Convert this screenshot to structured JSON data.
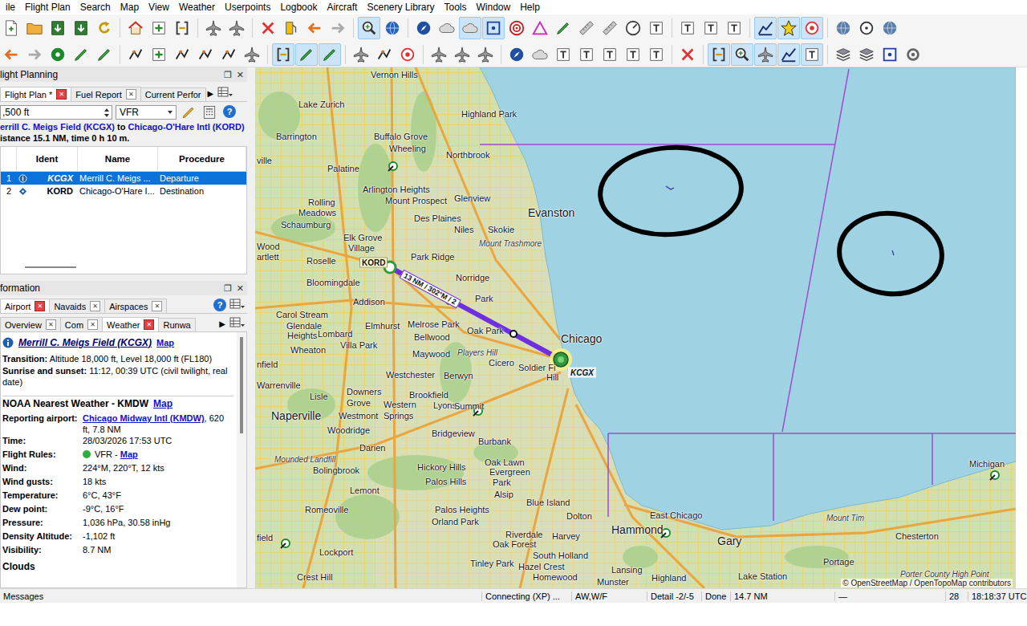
{
  "menu": [
    "ile",
    "Flight Plan",
    "Search",
    "Map",
    "View",
    "Weather",
    "Userpoints",
    "Logbook",
    "Aircraft",
    "Scenery Library",
    "Tools",
    "Window",
    "Help"
  ],
  "toolbar": [
    [
      {
        "kind": "new",
        "selected": false
      },
      {
        "kind": "open",
        "selected": false
      },
      {
        "kind": "save",
        "selected": false
      },
      {
        "kind": "save",
        "selected": false
      },
      {
        "kind": "refresh",
        "selected": false
      },
      {
        "kind": "sep",
        "selected": false
      },
      {
        "kind": "home",
        "selected": false
      },
      {
        "kind": "plus",
        "selected": false
      },
      {
        "kind": "bracket",
        "selected": false
      },
      {
        "kind": "sep",
        "selected": false
      },
      {
        "kind": "plane",
        "selected": false
      },
      {
        "kind": "plane",
        "selected": false
      },
      {
        "kind": "sep",
        "selected": false
      },
      {
        "kind": "cross",
        "selected": false
      },
      {
        "kind": "fuel",
        "selected": false
      },
      {
        "kind": "back",
        "selected": false
      },
      {
        "kind": "forward",
        "selected": false
      },
      {
        "kind": "sep",
        "selected": false
      },
      {
        "kind": "search",
        "selected": true
      },
      {
        "kind": "globe",
        "selected": false
      },
      {
        "kind": "sep",
        "selected": false
      },
      {
        "kind": "compass",
        "selected": false
      },
      {
        "kind": "cloud",
        "selected": false
      },
      {
        "kind": "cloud",
        "selected": true
      },
      {
        "kind": "square",
        "selected": true
      },
      {
        "kind": "radar",
        "selected": false
      },
      {
        "kind": "triangle",
        "selected": false
      },
      {
        "kind": "pen",
        "selected": false
      },
      {
        "kind": "ruler",
        "selected": false
      },
      {
        "kind": "ruler",
        "selected": false
      },
      {
        "kind": "gauge",
        "selected": false
      },
      {
        "kind": "text",
        "selected": false
      },
      {
        "kind": "sep",
        "selected": false
      },
      {
        "kind": "text",
        "selected": false
      },
      {
        "kind": "text",
        "selected": false
      },
      {
        "kind": "text",
        "selected": false
      },
      {
        "kind": "sep",
        "selected": false
      },
      {
        "kind": "chart",
        "selected": true
      },
      {
        "kind": "star",
        "selected": true
      },
      {
        "kind": "target",
        "selected": true
      },
      {
        "kind": "sep",
        "selected": false
      },
      {
        "kind": "sphere",
        "selected": false
      },
      {
        "kind": "circle",
        "selected": false
      },
      {
        "kind": "sphere",
        "selected": false
      }
    ],
    [
      {
        "kind": "back",
        "selected": false
      },
      {
        "kind": "forward",
        "selected": false
      },
      {
        "kind": "circlegreen",
        "selected": false
      },
      {
        "kind": "pen",
        "selected": false
      },
      {
        "kind": "pen",
        "selected": false
      },
      {
        "kind": "sep",
        "selected": false
      },
      {
        "kind": "route",
        "selected": false
      },
      {
        "kind": "plus",
        "selected": false
      },
      {
        "kind": "route",
        "selected": false
      },
      {
        "kind": "route",
        "selected": false
      },
      {
        "kind": "route",
        "selected": false
      },
      {
        "kind": "plane",
        "selected": false
      },
      {
        "kind": "sep",
        "selected": false
      },
      {
        "kind": "bracket",
        "selected": true
      },
      {
        "kind": "pen",
        "selected": true
      },
      {
        "kind": "pen",
        "selected": true
      },
      {
        "kind": "sep",
        "selected": false
      },
      {
        "kind": "plane",
        "selected": false
      },
      {
        "kind": "route",
        "selected": false
      },
      {
        "kind": "target",
        "selected": false
      },
      {
        "kind": "sep",
        "selected": false
      },
      {
        "kind": "plane",
        "selected": false
      },
      {
        "kind": "plane",
        "selected": false
      },
      {
        "kind": "plane",
        "selected": false
      },
      {
        "kind": "sep",
        "selected": false
      },
      {
        "kind": "compass",
        "selected": false
      },
      {
        "kind": "cloud",
        "selected": false
      },
      {
        "kind": "text",
        "selected": false
      },
      {
        "kind": "text",
        "selected": false
      },
      {
        "kind": "text",
        "selected": false
      },
      {
        "kind": "text",
        "selected": false
      },
      {
        "kind": "text",
        "selected": false
      },
      {
        "kind": "sep",
        "selected": false
      },
      {
        "kind": "cross",
        "selected": false
      },
      {
        "kind": "sep",
        "selected": false
      },
      {
        "kind": "bracket",
        "selected": true
      },
      {
        "kind": "search",
        "selected": true
      },
      {
        "kind": "plane",
        "selected": true
      },
      {
        "kind": "chart",
        "selected": true
      },
      {
        "kind": "text",
        "selected": true
      },
      {
        "kind": "sep",
        "selected": false
      },
      {
        "kind": "layers",
        "selected": false
      },
      {
        "kind": "layers",
        "selected": false
      },
      {
        "kind": "square",
        "selected": false
      },
      {
        "kind": "gear",
        "selected": false
      }
    ]
  ],
  "flight_planning": {
    "title": "light Planning",
    "dock_buttons": [
      "❐",
      "✕"
    ],
    "close_glyph": "✕",
    "tabs": [
      {
        "label": "Flight Plan *",
        "selected": true,
        "closable": true
      },
      {
        "label": "Fuel Report",
        "selected": false,
        "closable": true
      },
      {
        "label": "Current Perfor",
        "selected": false,
        "closable": false
      }
    ],
    "more": "▶",
    "altitude": ",500 ft",
    "flight_rules": "VFR",
    "help": "?",
    "route": {
      "from": "errill C. Meigs Field (KCGX)",
      "joiner": "to",
      "to": "Chicago-O'Hare Intl (KORD)"
    },
    "summary": "istance 15.1 NM, time 0 h 10 m.",
    "table": {
      "columns": [
        "",
        "Ident",
        "Name",
        "Procedure"
      ],
      "rows": [
        {
          "num": "1",
          "kind": "departure",
          "ident": "KCGX",
          "name": "Merrill C. Meigs ...",
          "procedure": "Departure",
          "selected": true
        },
        {
          "num": "2",
          "kind": "destination",
          "ident": "KORD",
          "name": "Chicago-O'Hare I...",
          "procedure": "Destination",
          "selected": false
        }
      ]
    }
  },
  "information": {
    "title": "formation",
    "dock_buttons": [
      "❐",
      "✕"
    ],
    "close_glyph": "✕",
    "help": "?",
    "more": "▶",
    "tab_rows": [
      [
        {
          "label": "Airport",
          "selected": true,
          "closable": true
        },
        {
          "label": "Navaids",
          "selected": false,
          "closable": true
        },
        {
          "label": "Airspaces",
          "selected": false,
          "closable": true
        }
      ],
      [
        {
          "label": "Overview",
          "selected": false,
          "closable": true
        },
        {
          "label": "Com",
          "selected": false,
          "closable": true
        },
        {
          "label": "Weather",
          "selected": true,
          "closable": true
        },
        {
          "label": "Runwa",
          "selected": false,
          "closable": false
        }
      ]
    ],
    "airport": {
      "name": "Merrill C. Meigs Field (KCGX)",
      "link": "Map"
    },
    "facts": [
      {
        "label": "Transition:",
        "value": "Altitude 18,000 ft, Level 18,000 ft (FL180)"
      },
      {
        "label": "Sunrise and sunset:",
        "value": "11:12, 00:39 UTC (civil twilight, real date)"
      }
    ],
    "weather": {
      "title": "NOAA Nearest Weather - KMDW",
      "link": "Map",
      "rows": [
        {
          "label": "Reporting airport:",
          "kind": "link-first",
          "link": "Chicago Midway Intl (KMDW)",
          "value": ", 620 ft, 7.8 NM"
        },
        {
          "label": "Time:",
          "kind": "plain",
          "value": "28/03/2026 17:53 UTC"
        },
        {
          "label": "Flight Rules:",
          "kind": "rules",
          "value": "VFR - ",
          "link": "Map"
        },
        {
          "label": "Wind:",
          "kind": "plain",
          "value": "224°M, 220°T, 12 kts"
        },
        {
          "label": "Wind gusts:",
          "kind": "plain",
          "value": "18 kts"
        },
        {
          "label": "Temperature:",
          "kind": "plain",
          "value": "6°C, 43°F"
        },
        {
          "label": "Dew point:",
          "kind": "plain",
          "value": "-9°C, 16°F"
        },
        {
          "label": "Pressure:",
          "kind": "plain",
          "value": "1,036 hPa, 30.58 inHg"
        },
        {
          "label": "Density Altitude:",
          "kind": "plain",
          "value": "-1,102 ft"
        },
        {
          "label": "Visibility:",
          "kind": "plain",
          "value": "8.7 NM"
        }
      ]
    },
    "next_section": "Clouds"
  },
  "map": {
    "places": [
      {
        "name": "Vernon Hills",
        "kind": "town"
      },
      {
        "name": "Lake Zurich",
        "kind": "town"
      },
      {
        "name": "Highland Park",
        "kind": "town"
      },
      {
        "name": "Barrington",
        "kind": "town"
      },
      {
        "name": "Buffalo Grove",
        "kind": "town"
      },
      {
        "name": "Wheeling",
        "kind": "town"
      },
      {
        "name": "Northbrook",
        "kind": "town"
      },
      {
        "name": "ville",
        "kind": "town"
      },
      {
        "name": "Palatine",
        "kind": "town"
      },
      {
        "name": "Arlington Heights",
        "kind": "town"
      },
      {
        "name": "Mount Prospect",
        "kind": "town"
      },
      {
        "name": "Glenview",
        "kind": "town"
      },
      {
        "name": "Evanston",
        "kind": "city"
      },
      {
        "name": "Rolling",
        "kind": "town"
      },
      {
        "name": "Meadows",
        "kind": "town"
      },
      {
        "name": "Des Plaines",
        "kind": "town"
      },
      {
        "name": "Niles",
        "kind": "town"
      },
      {
        "name": "Skokie",
        "kind": "town"
      },
      {
        "name": "Schaumburg",
        "kind": "town"
      },
      {
        "name": "Elk Grove",
        "kind": "town"
      },
      {
        "name": "Mount Trashmore",
        "kind": "feature"
      },
      {
        "name": "Wood",
        "kind": "town"
      },
      {
        "name": "Village",
        "kind": "town"
      },
      {
        "name": "Park Ridge",
        "kind": "town"
      },
      {
        "name": "artlett",
        "kind": "town"
      },
      {
        "name": "Roselle",
        "kind": "town"
      },
      {
        "name": "Norridge",
        "kind": "town"
      },
      {
        "name": "Bloomingdale",
        "kind": "town"
      },
      {
        "name": "Addison",
        "kind": "town"
      },
      {
        "name": "Park",
        "kind": "town"
      },
      {
        "name": "Carol Stream",
        "kind": "town"
      },
      {
        "name": "Glendale",
        "kind": "town"
      },
      {
        "name": "Heights",
        "kind": "town"
      },
      {
        "name": "Lombard",
        "kind": "town"
      },
      {
        "name": "Elmhurst",
        "kind": "town"
      },
      {
        "name": "Melrose Park",
        "kind": "town"
      },
      {
        "name": "Oak Park",
        "kind": "town"
      },
      {
        "name": "Villa Park",
        "kind": "town"
      },
      {
        "name": "Bellwood",
        "kind": "town"
      },
      {
        "name": "Chicago",
        "kind": "city"
      },
      {
        "name": "Wheaton",
        "kind": "town"
      },
      {
        "name": "Maywood",
        "kind": "town"
      },
      {
        "name": "Players Hill",
        "kind": "feature"
      },
      {
        "name": "nfield",
        "kind": "town"
      },
      {
        "name": "Cicero",
        "kind": "town"
      },
      {
        "name": "Westchester",
        "kind": "town"
      },
      {
        "name": "Berwyn",
        "kind": "town"
      },
      {
        "name": "Hill",
        "kind": "town"
      },
      {
        "name": "Warrenville",
        "kind": "town"
      },
      {
        "name": "Lisle",
        "kind": "town"
      },
      {
        "name": "Downers",
        "kind": "town"
      },
      {
        "name": "Grove",
        "kind": "town"
      },
      {
        "name": "Brookfield",
        "kind": "town"
      },
      {
        "name": "Western",
        "kind": "town"
      },
      {
        "name": "Lyons",
        "kind": "town"
      },
      {
        "name": "Summit",
        "kind": "town"
      },
      {
        "name": "Naperville",
        "kind": "city"
      },
      {
        "name": "Westmont",
        "kind": "town"
      },
      {
        "name": "Springs",
        "kind": "town"
      },
      {
        "name": "Woodridge",
        "kind": "town"
      },
      {
        "name": "Bridgeview",
        "kind": "town"
      },
      {
        "name": "Burbank",
        "kind": "town"
      },
      {
        "name": "Darien",
        "kind": "town"
      },
      {
        "name": "Mounded Landfill",
        "kind": "feature"
      },
      {
        "name": "Oak Lawn",
        "kind": "town"
      },
      {
        "name": "Hickory Hills",
        "kind": "town"
      },
      {
        "name": "Bolingbrook",
        "kind": "town"
      },
      {
        "name": "Evergreen",
        "kind": "town"
      },
      {
        "name": "Palos Hills",
        "kind": "town"
      },
      {
        "name": "Park",
        "kind": "town"
      },
      {
        "name": "Lemont",
        "kind": "town"
      },
      {
        "name": "Alsip",
        "kind": "town"
      },
      {
        "name": "Blue Island",
        "kind": "town"
      },
      {
        "name": "Romeoville",
        "kind": "town"
      },
      {
        "name": "Palos Heights",
        "kind": "town"
      },
      {
        "name": "Dolton",
        "kind": "town"
      },
      {
        "name": "East Chicago",
        "kind": "town"
      },
      {
        "name": "Mount Tim",
        "kind": "feature"
      },
      {
        "name": "Orland Park",
        "kind": "town"
      },
      {
        "name": "Hammond",
        "kind": "city"
      },
      {
        "name": "Riverdale",
        "kind": "town"
      },
      {
        "name": "Harvey",
        "kind": "town"
      },
      {
        "name": "Chesterton",
        "kind": "town"
      },
      {
        "name": "field",
        "kind": "town"
      },
      {
        "name": "Gary",
        "kind": "city"
      },
      {
        "name": "Oak Forest",
        "kind": "town"
      },
      {
        "name": "Lockport",
        "kind": "town"
      },
      {
        "name": "South Holland",
        "kind": "town"
      },
      {
        "name": "Portage",
        "kind": "town"
      },
      {
        "name": "Tinley Park",
        "kind": "town"
      },
      {
        "name": "Hazel Crest",
        "kind": "town"
      },
      {
        "name": "Lansing",
        "kind": "town"
      },
      {
        "name": "Porter County High Point",
        "kind": "feature"
      },
      {
        "name": "Lake Station",
        "kind": "town"
      },
      {
        "name": "Crest Hill",
        "kind": "town"
      },
      {
        "name": "Homewood",
        "kind": "town"
      },
      {
        "name": "Highland",
        "kind": "town"
      },
      {
        "name": "Munster",
        "kind": "town"
      },
      {
        "name": "Michigan",
        "kind": "town"
      },
      {
        "name": "Soldier Fi",
        "kind": "town"
      }
    ],
    "airports": [
      {
        "ident": "KORD",
        "kind": "destination"
      },
      {
        "ident": "KCGX",
        "kind": "departure"
      }
    ],
    "route_label": "13 NM / 302°M / 2",
    "attribution": "© OpenStreetMap / OpenTopoMap contributors"
  },
  "status_bar": [
    "Messages",
    "Connecting (XP) ...",
    "AW,W/F",
    "Detail -2/-5",
    "Done",
    "14.7 NM",
    "—",
    "28",
    "18:18:37 UTC"
  ]
}
